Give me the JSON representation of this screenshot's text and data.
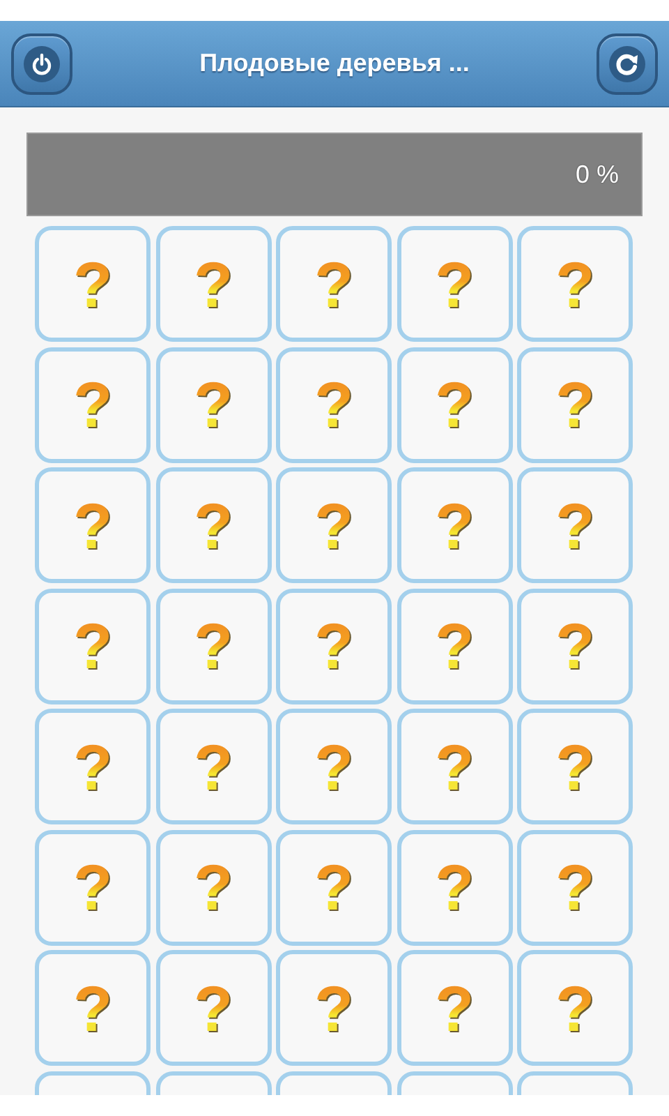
{
  "header": {
    "title": "Плодовые деревья ..."
  },
  "progress": {
    "level": 0,
    "reading": "0 %"
  },
  "board": {
    "rows": [
      {
        "cards": [
          {
            "kind": "card",
            "face": "?"
          },
          {
            "kind": "card",
            "face": "?"
          },
          {
            "kind": "card",
            "face": "?"
          },
          {
            "kind": "card",
            "face": "?"
          },
          {
            "kind": "card",
            "face": "?"
          }
        ]
      },
      {
        "cards": [
          {
            "kind": "card",
            "face": "?"
          },
          {
            "kind": "card",
            "face": "?"
          },
          {
            "kind": "card",
            "face": "?"
          },
          {
            "kind": "card",
            "face": "?"
          },
          {
            "kind": "card",
            "face": "?"
          }
        ]
      },
      {
        "cards": [
          {
            "kind": "card",
            "face": "?"
          },
          {
            "kind": "card",
            "face": "?"
          },
          {
            "kind": "card",
            "face": "?"
          },
          {
            "kind": "card",
            "face": "?"
          },
          {
            "kind": "card",
            "face": "?"
          }
        ]
      },
      {
        "cards": [
          {
            "kind": "card",
            "face": "?"
          },
          {
            "kind": "card",
            "face": "?"
          },
          {
            "kind": "card",
            "face": "?"
          },
          {
            "kind": "card",
            "face": "?"
          },
          {
            "kind": "card",
            "face": "?"
          }
        ]
      },
      {
        "cards": [
          {
            "kind": "card",
            "face": "?"
          },
          {
            "kind": "card",
            "face": "?"
          },
          {
            "kind": "card",
            "face": "?"
          },
          {
            "kind": "card",
            "face": "?"
          },
          {
            "kind": "card",
            "face": "?"
          }
        ]
      },
      {
        "cards": [
          {
            "kind": "card",
            "face": "?"
          },
          {
            "kind": "card",
            "face": "?"
          },
          {
            "kind": "card",
            "face": "?"
          },
          {
            "kind": "card",
            "face": "?"
          },
          {
            "kind": "card",
            "face": "?"
          }
        ]
      },
      {
        "cards": [
          {
            "kind": "card",
            "face": "?"
          },
          {
            "kind": "card",
            "face": "?"
          },
          {
            "kind": "card",
            "face": "?"
          },
          {
            "kind": "card",
            "face": "?"
          },
          {
            "kind": "card",
            "face": "?"
          }
        ]
      },
      {
        "cards": [
          {
            "kind": "card"
          },
          {
            "kind": "card"
          },
          {
            "kind": "card"
          },
          {
            "kind": "card"
          },
          {
            "kind": "card"
          }
        ]
      }
    ]
  }
}
